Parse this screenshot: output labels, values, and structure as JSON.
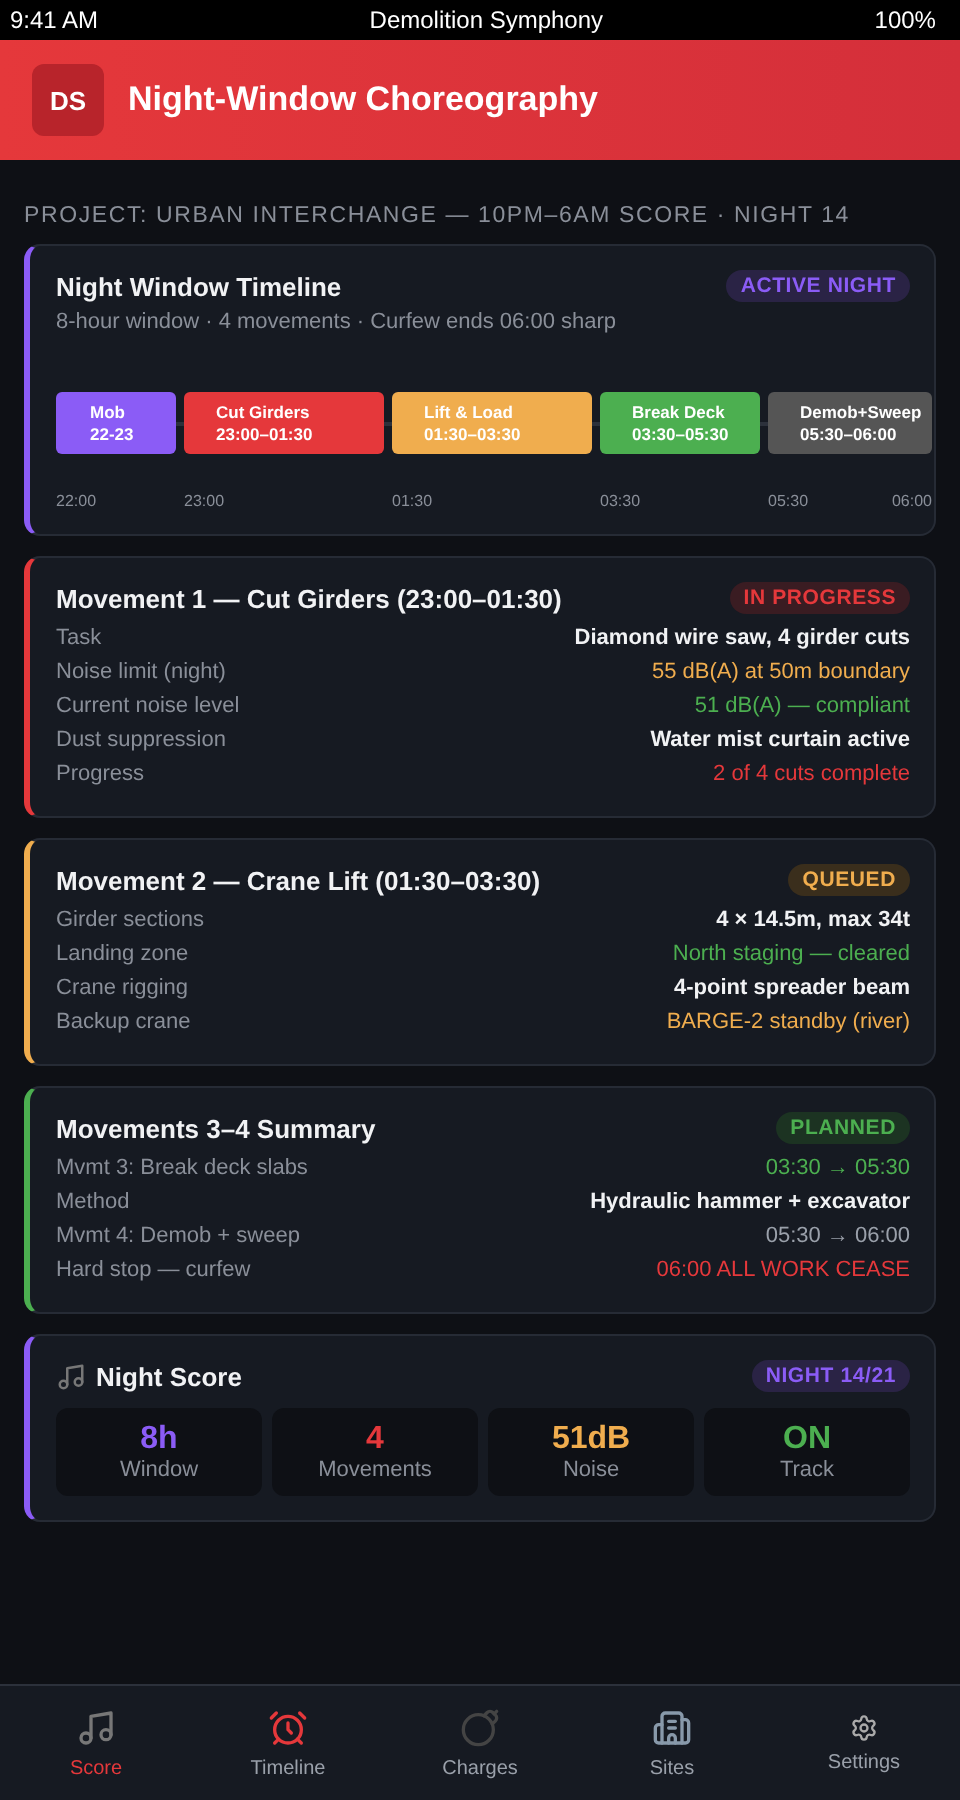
{
  "status_bar": {
    "time": "9:41 AM",
    "title": "Demolition Symphony",
    "battery": "100%"
  },
  "header": {
    "badge": "DS",
    "title": "Night-Window Choreography"
  },
  "project_label": "PROJECT: URBAN INTERCHANGE — 10PM–6AM SCORE · NIGHT 14",
  "timeline": {
    "title": "Night Window Timeline",
    "badge": "ACTIVE NIGHT",
    "subtitle": "8-hour window · 4 movements · Curfew ends 06:00 sharp",
    "end_tick": "06:00",
    "segments": [
      {
        "name": "Mob",
        "time": "22-23",
        "tick": "22:00",
        "color": "#8b5cf6"
      },
      {
        "name": "Cut Girders",
        "time": "23:00–01:30",
        "tick": "23:00",
        "color": "#e5383b"
      },
      {
        "name": "Lift & Load",
        "time": "01:30–03:30",
        "tick": "01:30",
        "color": "#f0ad4e"
      },
      {
        "name": "Break Deck",
        "time": "03:30–05:30",
        "tick": "03:30",
        "color": "#4caf50"
      },
      {
        "name": "Demob+Sweep",
        "time": "05:30–06:00",
        "tick": "05:30",
        "color": "#555555"
      }
    ]
  },
  "cards": [
    {
      "title": "Movement 1 — Cut Girders (23:00–01:30)",
      "badge": "IN PROGRESS",
      "kind": "progress",
      "rows": [
        {
          "label": "Task",
          "value": "Diamond wire saw, 4 girder cuts",
          "kind": "bold"
        },
        {
          "label": "Noise limit (night)",
          "value": "55 dB(A) at 50m boundary",
          "kind": "warn"
        },
        {
          "label": "Current noise level",
          "value": "51 dB(A) — compliant",
          "kind": "ok"
        },
        {
          "label": "Dust suppression",
          "value": "Water mist curtain active",
          "kind": "bold"
        },
        {
          "label": "Progress",
          "value": "2 of 4 cuts complete",
          "kind": "alert"
        }
      ]
    },
    {
      "title": "Movement 2 — Crane Lift (01:30–03:30)",
      "badge": "QUEUED",
      "kind": "queued",
      "rows": [
        {
          "label": "Girder sections",
          "value": "4 × 14.5m, max 34t",
          "kind": "bold"
        },
        {
          "label": "Landing zone",
          "value": "North staging — cleared",
          "kind": "ok"
        },
        {
          "label": "Crane rigging",
          "value": "4-point spreader beam",
          "kind": "bold"
        },
        {
          "label": "Backup crane",
          "value": "BARGE-2 standby (river)",
          "kind": "warn"
        }
      ]
    },
    {
      "title": "Movements 3–4 Summary",
      "badge": "PLANNED",
      "kind": "planned",
      "rows": [
        {
          "label": "Mvmt 3: Break deck slabs",
          "value": "03:30 → 05:30",
          "kind": "ok"
        },
        {
          "label": "Method",
          "value": "Hydraulic hammer + excavator",
          "kind": "bold"
        },
        {
          "label": "Mvmt 4: Demob + sweep",
          "value": "05:30 → 06:00",
          "kind": "muted"
        },
        {
          "label": "Hard stop — curfew",
          "value": "06:00 ALL WORK CEASE",
          "kind": "alert"
        }
      ]
    }
  ],
  "score": {
    "title": "Night Score",
    "badge": "NIGHT 14/21",
    "stats": [
      {
        "value": "8h",
        "label": "Window",
        "color": "#8b5cf6"
      },
      {
        "value": "4",
        "label": "Movements",
        "color": "#e5383b"
      },
      {
        "value": "51dB",
        "label": "Noise",
        "color": "#f0ad4e"
      },
      {
        "value": "ON",
        "label": "Track",
        "color": "#4caf50"
      }
    ]
  },
  "nav": [
    {
      "label": "Score",
      "kind": "score",
      "selected": true
    },
    {
      "label": "Timeline",
      "kind": "clock",
      "selected": false
    },
    {
      "label": "Charges",
      "kind": "bomb",
      "selected": false
    },
    {
      "label": "Sites",
      "kind": "building",
      "selected": false
    },
    {
      "label": "Settings",
      "kind": "gear",
      "selected": false
    }
  ]
}
